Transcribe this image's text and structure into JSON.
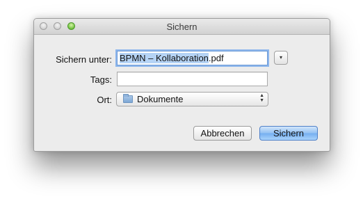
{
  "window": {
    "title": "Sichern"
  },
  "form": {
    "save_as": {
      "label": "Sichern unter:",
      "selected_text": "BPMN – Kollaboration",
      "extension": ".pdf"
    },
    "tags": {
      "label": "Tags:",
      "value": ""
    },
    "location": {
      "label": "Ort:",
      "value": "Dokumente",
      "icon": "folder-icon"
    },
    "expand_icon": "▾"
  },
  "buttons": {
    "cancel": "Abbrechen",
    "save": "Sichern"
  },
  "colors": {
    "selection": "#b5d3f5",
    "default_button": "#74aef0",
    "zoom_button": "#6fbf3c"
  }
}
